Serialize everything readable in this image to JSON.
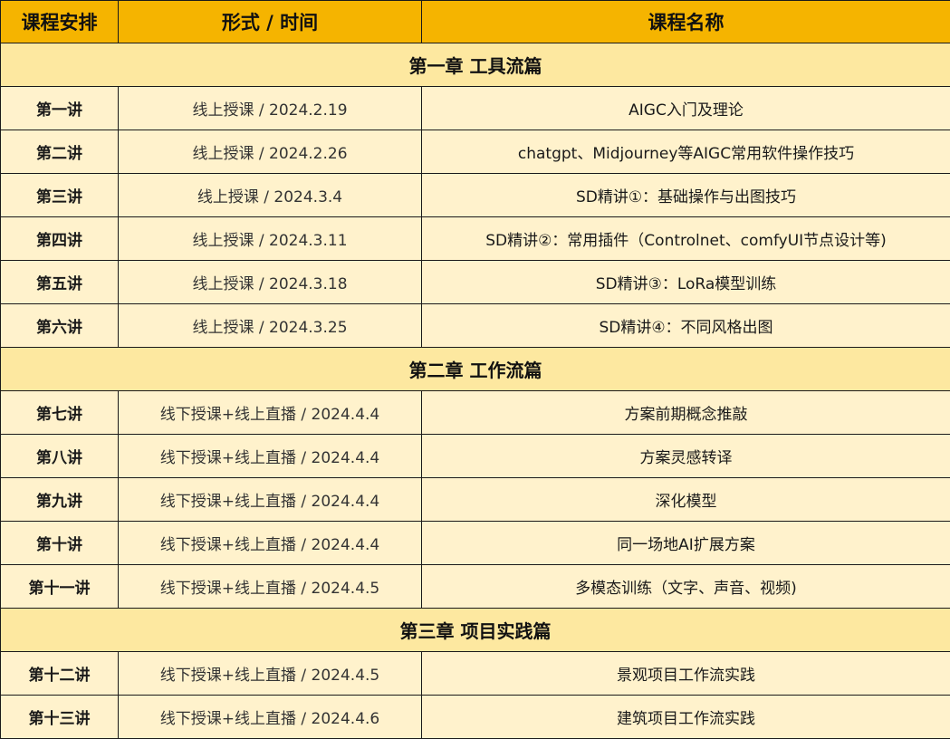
{
  "header": {
    "col1": "课程安排",
    "col2": "形式 / 时间",
    "col3": "课程名称"
  },
  "sections": [
    {
      "chapter": "第一章  工具流篇",
      "rows": [
        {
          "lesson": "第一讲",
          "format": "线上授课 / 2024.2.19",
          "name": "AIGC入门及理论"
        },
        {
          "lesson": "第二讲",
          "format": "线上授课 / 2024.2.26",
          "name": "chatgpt、Midjourney等AIGC常用软件操作技巧"
        },
        {
          "lesson": "第三讲",
          "format": "线上授课 / 2024.3.4",
          "name": "SD精讲①：基础操作与出图技巧"
        },
        {
          "lesson": "第四讲",
          "format": "线上授课 / 2024.3.11",
          "name": "SD精讲②：常用插件（Controlnet、comfyUI节点设计等)"
        },
        {
          "lesson": "第五讲",
          "format": "线上授课 / 2024.3.18",
          "name": "SD精讲③：LoRa模型训练"
        },
        {
          "lesson": "第六讲",
          "format": "线上授课 / 2024.3.25",
          "name": "SD精讲④：不同风格出图"
        }
      ]
    },
    {
      "chapter": "第二章  工作流篇",
      "rows": [
        {
          "lesson": "第七讲",
          "format": "线下授课+线上直播 / 2024.4.4",
          "name": "方案前期概念推敲"
        },
        {
          "lesson": "第八讲",
          "format": "线下授课+线上直播 / 2024.4.4",
          "name": "方案灵感转译"
        },
        {
          "lesson": "第九讲",
          "format": "线下授课+线上直播 / 2024.4.4",
          "name": "深化模型"
        },
        {
          "lesson": "第十讲",
          "format": "线下授课+线上直播 / 2024.4.4",
          "name": "同一场地AI扩展方案"
        },
        {
          "lesson": "第十一讲",
          "format": "线下授课+线上直播 / 2024.4.5",
          "name": "多模态训练（文字、声音、视频)"
        }
      ]
    },
    {
      "chapter": "第三章  项目实践篇",
      "rows": [
        {
          "lesson": "第十二讲",
          "format": "线下授课+线上直播 / 2024.4.5",
          "name": "景观项目工作流实践"
        },
        {
          "lesson": "第十三讲",
          "format": "线下授课+线上直播 / 2024.4.6",
          "name": "建筑项目工作流实践"
        }
      ]
    }
  ]
}
